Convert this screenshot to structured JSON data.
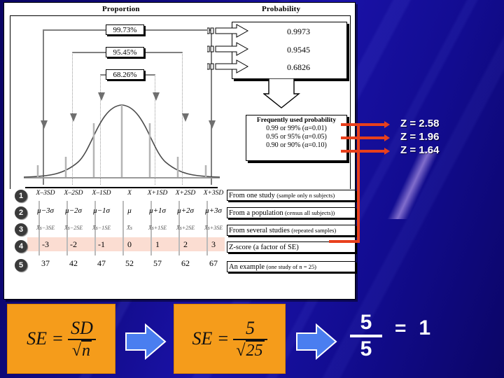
{
  "headers": {
    "proportion": "Proportion",
    "probability": "Probability"
  },
  "proportion_boxes": [
    {
      "label": "99.73%"
    },
    {
      "label": "95.45%"
    },
    {
      "label": "68.26%"
    }
  ],
  "probability_values": [
    "0.9973",
    "0.9545",
    "0.6826"
  ],
  "frequently_used": {
    "title": "Frequently used probability",
    "lines": [
      "0.99 or 99% (α=0.01)",
      "0.95 or 95% (α=0.05)",
      "0.90 or 90% (α=0.10)"
    ]
  },
  "z_values": [
    "Z = 2.58",
    "Z = 1.96",
    "Z = 1.64"
  ],
  "table": {
    "row_numbers": [
      "1",
      "2",
      "3",
      "4",
      "5"
    ],
    "rows": [
      {
        "id": "1",
        "cells": [
          "X–3SD",
          "X–2SD",
          "X–1SD",
          "X",
          "X+1SD",
          "X+2SD",
          "X+3SD"
        ],
        "description_main": "From one study",
        "description_sub": "(sample only n subjects)"
      },
      {
        "id": "2",
        "cells": [
          "μ−3σ",
          "μ−2σ",
          "μ−1σ",
          "μ",
          "μ+1σ",
          "μ+2σ",
          "μ+3σ"
        ],
        "description_main": "From a population",
        "description_sub": "(census all subjects))"
      },
      {
        "id": "3",
        "cells": [
          "X̄s−3SE",
          "X̄s−2SE",
          "X̄s−1SE",
          "X̄s",
          "X̄s+1SE",
          "X̄s+2SE",
          "X̄s+3SE"
        ],
        "description_main": "From several studies",
        "description_sub": "(repeated samples)"
      },
      {
        "id": "4",
        "cells": [
          "-3",
          "-2",
          "-1",
          "0",
          "1",
          "2",
          "3"
        ],
        "description_main": "Z-score (a factor of SE)",
        "description_sub": ""
      },
      {
        "id": "5",
        "cells": [
          "37",
          "42",
          "47",
          "52",
          "57",
          "62",
          "67"
        ],
        "description_main": "An example",
        "description_sub": "(one study of n = 25)"
      }
    ]
  },
  "formulas": {
    "box1": {
      "lhs": "SE  =",
      "numerator": "SD",
      "denominator_radicand": "n"
    },
    "box2": {
      "lhs": "SE  =",
      "numerator": "5",
      "denominator_radicand": "25"
    },
    "result": {
      "numerator": "5",
      "denominator": "5",
      "equals": "=",
      "value": "1"
    }
  },
  "colors": {
    "accent_red": "#e8401c",
    "formula_orange": "#f59c1b",
    "arrow_blue": "#4a7ef0",
    "zscore_band": "#fbddd2",
    "background_blue": "#120a8c"
  },
  "icons": {
    "block_arrow_right": "block-arrow-right-icon",
    "block_arrow_down": "block-arrow-down-icon",
    "blue_arrow_right": "blue-block-arrow-right-icon"
  }
}
